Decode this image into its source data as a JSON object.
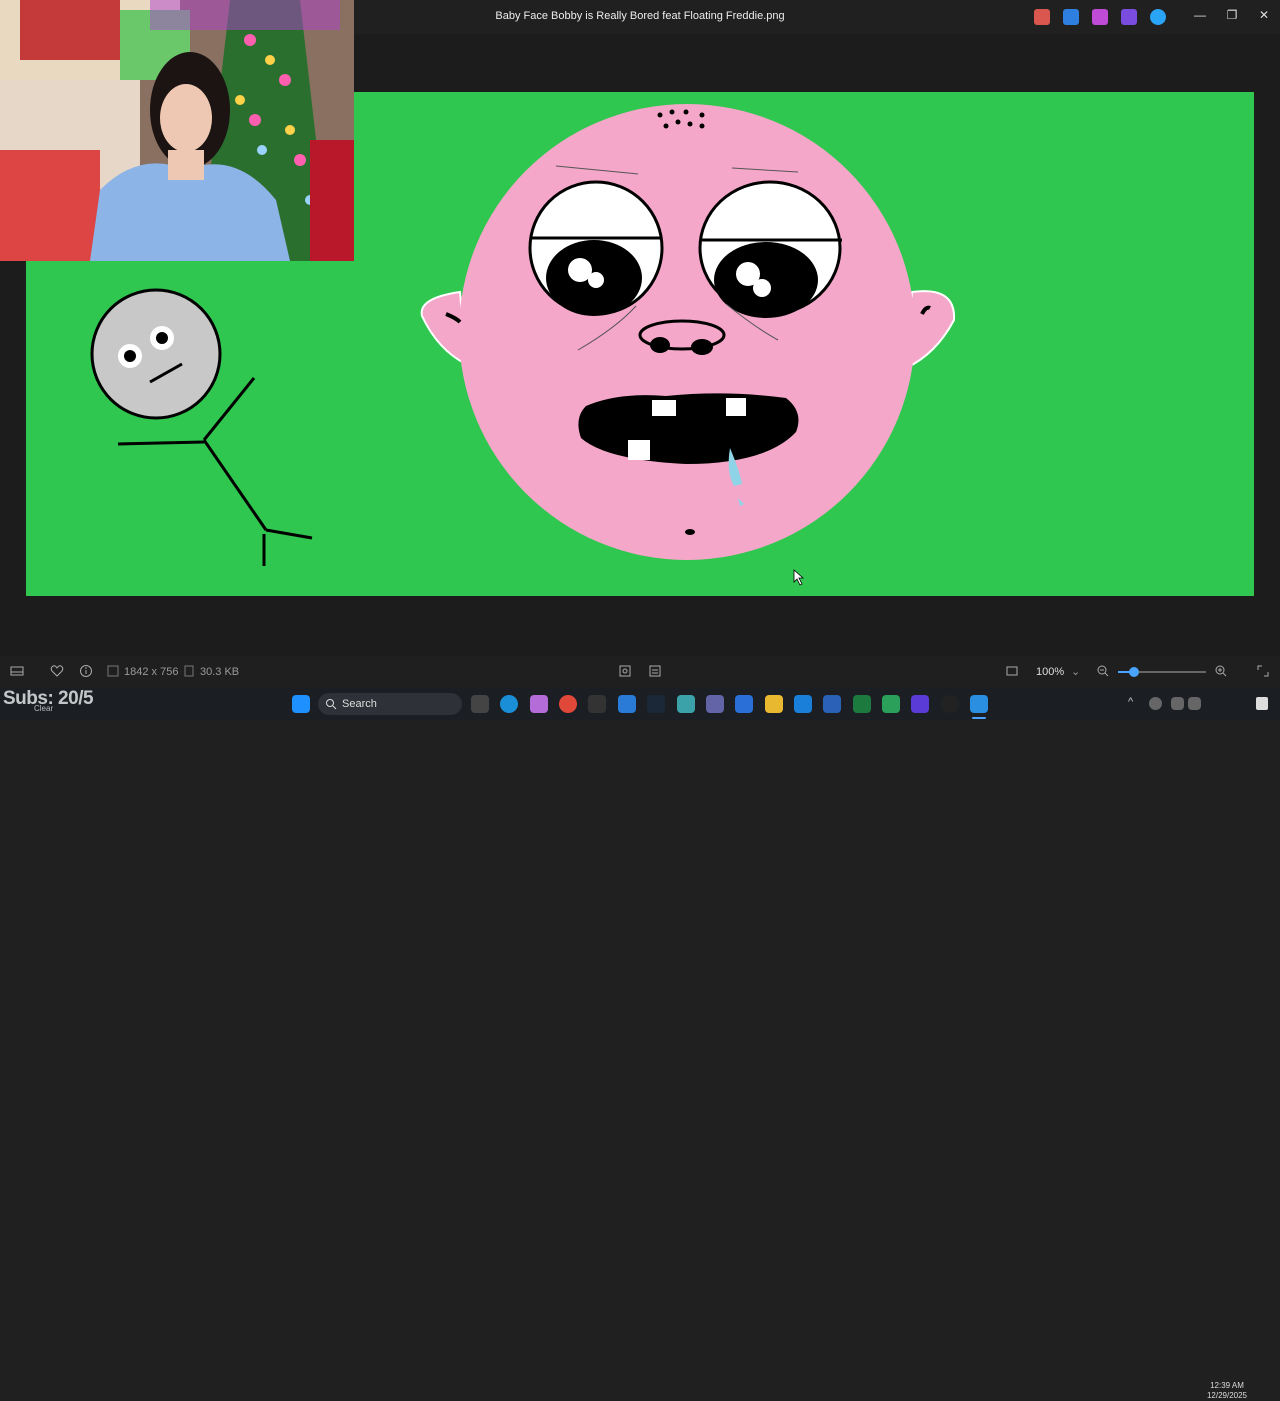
{
  "window": {
    "title": "Baby Face Bobby is Really Bored feat Floating Freddie.png",
    "minimize_glyph": "—",
    "maximize_glyph": "❐",
    "close_glyph": "✕"
  },
  "titlebar_apps": [
    {
      "icon": "copilot-icon",
      "color": "#d9574f"
    },
    {
      "icon": "designer-icon",
      "color": "#2f7fe0"
    },
    {
      "icon": "clipchamp-icon",
      "color": "#c04bd6"
    },
    {
      "icon": "clipchamp-video-icon",
      "color": "#7a4de0"
    },
    {
      "icon": "onedrive-icon",
      "color": "#2aa4f4"
    }
  ],
  "statusbar": {
    "dimensions": "1842 x 756",
    "file_size": "30.3 KB",
    "zoom": "100%",
    "zoom_level": 0.18
  },
  "taskbar": {
    "search_placeholder": "Search",
    "clock_time": "12:39 AM",
    "clock_date": "12/29/2025",
    "weather": "Clear",
    "subs_overlay": "Subs: 20/5"
  },
  "colors": {
    "canvas_green": "#2fc74f",
    "face_pink": "#f4a7c8",
    "accent": "#4aa3ff"
  }
}
